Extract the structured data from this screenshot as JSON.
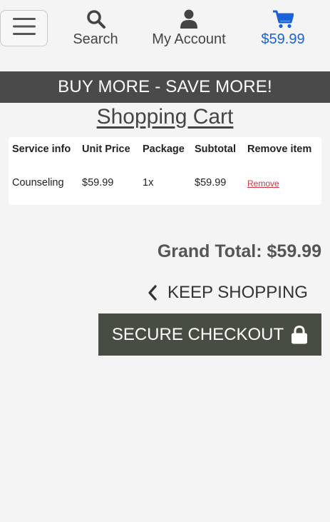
{
  "header": {
    "menu_icon": "hamburger-icon",
    "nav": [
      {
        "label": "Search",
        "icon": "search-icon"
      },
      {
        "label": "My Account",
        "icon": "user-icon"
      },
      {
        "label": "$59.99",
        "icon": "shopping-cart-icon"
      }
    ]
  },
  "promo": {
    "text": "BUY MORE - SAVE MORE!"
  },
  "page": {
    "title": "Shopping Cart"
  },
  "table": {
    "headers": [
      "Service info",
      "Unit Price",
      "Package",
      "Subtotal",
      "Remove item"
    ],
    "rows": [
      {
        "service": "Counseling",
        "unit_price": "$59.99",
        "package": "1x",
        "subtotal": "$59.99",
        "remove": "Remove"
      }
    ]
  },
  "summary": {
    "grand_total": "Grand Total: $59.99",
    "keep_shopping": "KEEP SHOPPING",
    "checkout": "SECURE CHECKOUT"
  },
  "colors": {
    "accent_blue": "#1a62d8",
    "promo_bg": "#4a4a4a",
    "checkout_bg": "#474d43",
    "remove_red": "#d0343e",
    "page_bg": "#f4f4f4"
  }
}
